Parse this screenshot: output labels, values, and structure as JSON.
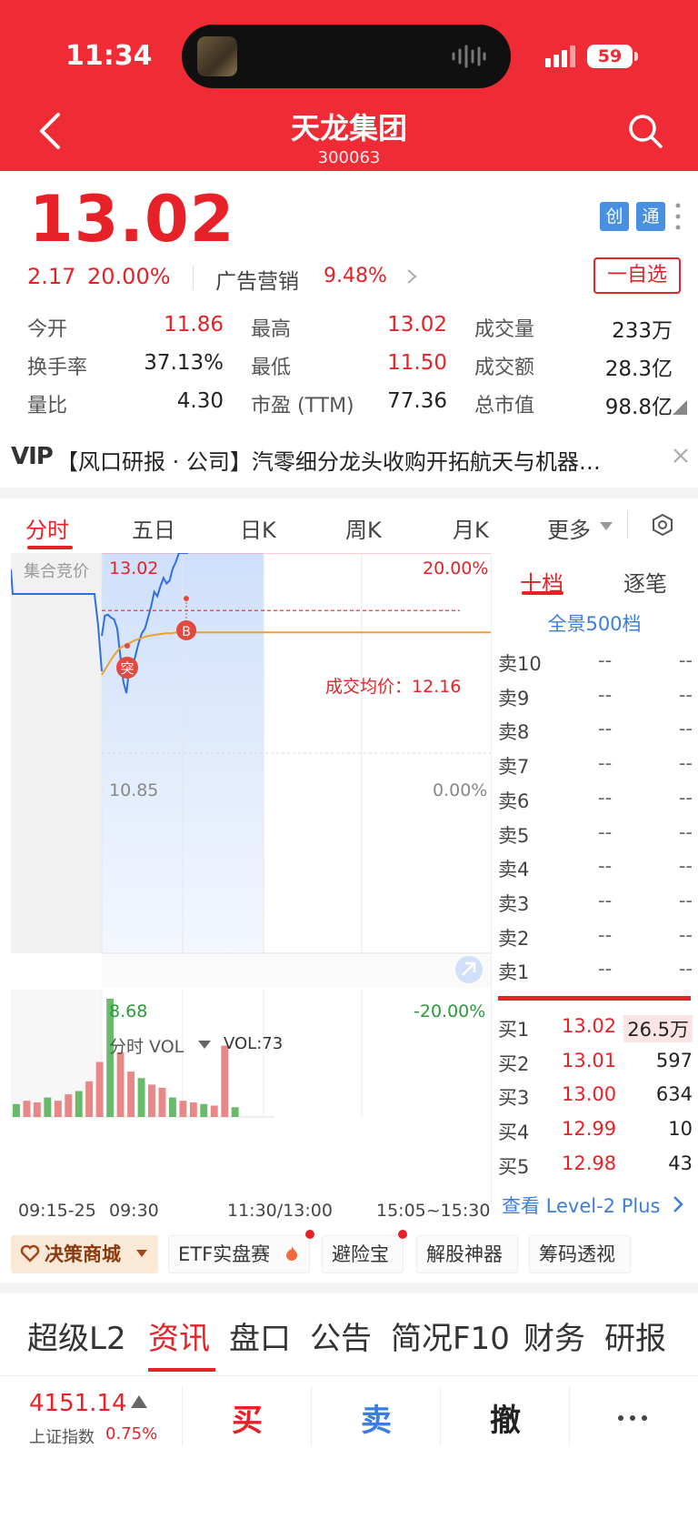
{
  "status": {
    "time": "11:34",
    "battery": "59"
  },
  "header": {
    "name": "天龙集团",
    "code": "300063"
  },
  "quote": {
    "price": "13.02",
    "change": "2.17",
    "change_pct": "20.00%",
    "badges": [
      "创",
      "通"
    ],
    "sector_name": "广告营销",
    "sector_pct": "9.48%",
    "watch_label": "一自选"
  },
  "stats": [
    {
      "label": "今开",
      "value": "11.86",
      "color": "red"
    },
    {
      "label": "最高",
      "value": "13.02",
      "color": "red"
    },
    {
      "label": "成交量",
      "value": "233万",
      "color": "blk"
    },
    {
      "label": "换手率",
      "value": "37.13%",
      "color": "blk"
    },
    {
      "label": "最低",
      "value": "11.50",
      "color": "red"
    },
    {
      "label": "成交额",
      "value": "28.3亿",
      "color": "blk"
    },
    {
      "label": "量比",
      "value": "4.30",
      "color": "blk"
    },
    {
      "label": "市盈 (TTM)",
      "value": "77.36",
      "color": "blk"
    },
    {
      "label": "总市值",
      "value": "98.8亿",
      "color": "blk"
    }
  ],
  "news": {
    "vip": "VIP",
    "text": "【风口研报 · 公司】汽零细分龙头收购开拓航天与机器…"
  },
  "chart_tabs": [
    "分时",
    "五日",
    "日K",
    "周K",
    "月K",
    "更多"
  ],
  "chart_labels": {
    "auction": "集合竞价",
    "top_price": "13.02",
    "top_pct": "20.00%",
    "mid_price": "10.85",
    "mid_pct": "0.00%",
    "bot_price": "8.68",
    "bot_pct": "-20.00%",
    "avg_label": "成交均价：12.16",
    "marker_tu": "突",
    "marker_b": "B",
    "vol_selector": "分时 VOL",
    "vol_value": "VOL:73",
    "x_ticks": [
      "09:15-25",
      "09:30",
      "11:30/13:00",
      "15:05~15:30"
    ]
  },
  "chart_data": {
    "type": "line",
    "title": "",
    "ylim": [
      8.68,
      13.02
    ],
    "prev_close": 10.85,
    "price_series": [
      12.12,
      12.34,
      12.35,
      12.32,
      12.3,
      12.2,
      11.9,
      11.62,
      11.5,
      11.8,
      11.78,
      11.92,
      12.05,
      12.15,
      12.2,
      12.32,
      12.44,
      12.6,
      12.55,
      12.66,
      12.75,
      12.69,
      12.72,
      12.85,
      12.92,
      13.02,
      13.02,
      13.02,
      13.02
    ],
    "avg_series": [
      11.7,
      11.8,
      11.9,
      11.98,
      12.02,
      12.05,
      12.08,
      12.1,
      12.12,
      12.13,
      12.14,
      12.15,
      12.15,
      12.16,
      12.16,
      12.16
    ],
    "volume": [
      8,
      10,
      9,
      12,
      10,
      14,
      16,
      22,
      34,
      73,
      40,
      28,
      24,
      20,
      18,
      12,
      10,
      9,
      8,
      7,
      44,
      6
    ]
  },
  "orderbook": {
    "tabs": [
      "十档",
      "逐笔"
    ],
    "full_label": "全景500档",
    "sells": [
      {
        "label": "卖10",
        "price": "--",
        "vol": "--"
      },
      {
        "label": "卖9",
        "price": "--",
        "vol": "--"
      },
      {
        "label": "卖8",
        "price": "--",
        "vol": "--"
      },
      {
        "label": "卖7",
        "price": "--",
        "vol": "--"
      },
      {
        "label": "卖6",
        "price": "--",
        "vol": "--"
      },
      {
        "label": "卖5",
        "price": "--",
        "vol": "--"
      },
      {
        "label": "卖4",
        "price": "--",
        "vol": "--"
      },
      {
        "label": "卖3",
        "price": "--",
        "vol": "--"
      },
      {
        "label": "卖2",
        "price": "--",
        "vol": "--"
      },
      {
        "label": "卖1",
        "price": "--",
        "vol": "--"
      }
    ],
    "buys": [
      {
        "label": "买1",
        "price": "13.02",
        "vol": "26.5万"
      },
      {
        "label": "买2",
        "price": "13.01",
        "vol": "597"
      },
      {
        "label": "买3",
        "price": "13.00",
        "vol": "634"
      },
      {
        "label": "买4",
        "price": "12.99",
        "vol": "10"
      },
      {
        "label": "买5",
        "price": "12.98",
        "vol": "43"
      }
    ],
    "l2_link": "查看 Level-2 Plus"
  },
  "tools": [
    "决策商城",
    "ETF实盘赛",
    "避险宝",
    "解股神器",
    "筹码透视"
  ],
  "news_tabs": [
    "超级L2",
    "资讯",
    "盘口",
    "公告",
    "简况F10",
    "财务",
    "研报"
  ],
  "bottom": {
    "index_value": "4151.14",
    "index_name": "上证指数",
    "index_pct": "0.75%",
    "buy": "买",
    "sell": "卖",
    "cancel": "撤"
  },
  "colors": {
    "accent": "#ef2b35",
    "rise": "#e62228",
    "link": "#3b7de0",
    "price_line": "#2f6ee6",
    "avg_line": "#f0a030"
  }
}
